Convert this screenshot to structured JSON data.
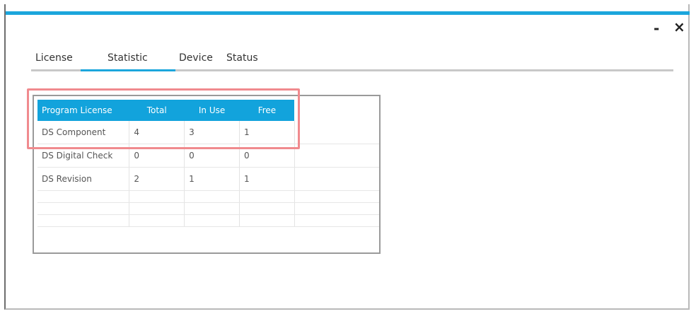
{
  "window": {
    "minimize_label": "-",
    "close_label": "×"
  },
  "tabs": [
    {
      "label": "License"
    },
    {
      "label": "Statistic",
      "active": true
    },
    {
      "label": "Device"
    },
    {
      "label": "Status"
    }
  ],
  "table": {
    "headers": [
      "Program License",
      "Total",
      "In Use",
      "Free"
    ],
    "rows": [
      [
        "DS Component",
        "4",
        "3",
        "1"
      ],
      [
        "DS Digital Check",
        "0",
        "0",
        "0"
      ],
      [
        "DS Revision",
        "2",
        "1",
        "1"
      ]
    ]
  },
  "colors": {
    "accent": "#1ca6dc",
    "header_bg": "#12a3dc",
    "highlight": "#f08a8e"
  }
}
